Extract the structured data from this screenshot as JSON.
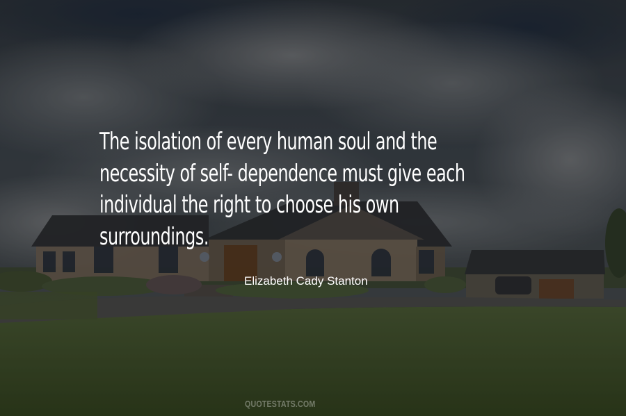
{
  "quote": {
    "lines": [
      "The isolation of every human soul and the",
      "necessity of self- dependence must give each",
      "individual the right to choose his own",
      "surroundings."
    ]
  },
  "author": "Elizabeth Cady Stanton",
  "watermark": "QUOTESTATS.COM",
  "colors": {
    "text": "#ffffff",
    "sky": "#3a4149",
    "grass": "#3a4a2c"
  }
}
